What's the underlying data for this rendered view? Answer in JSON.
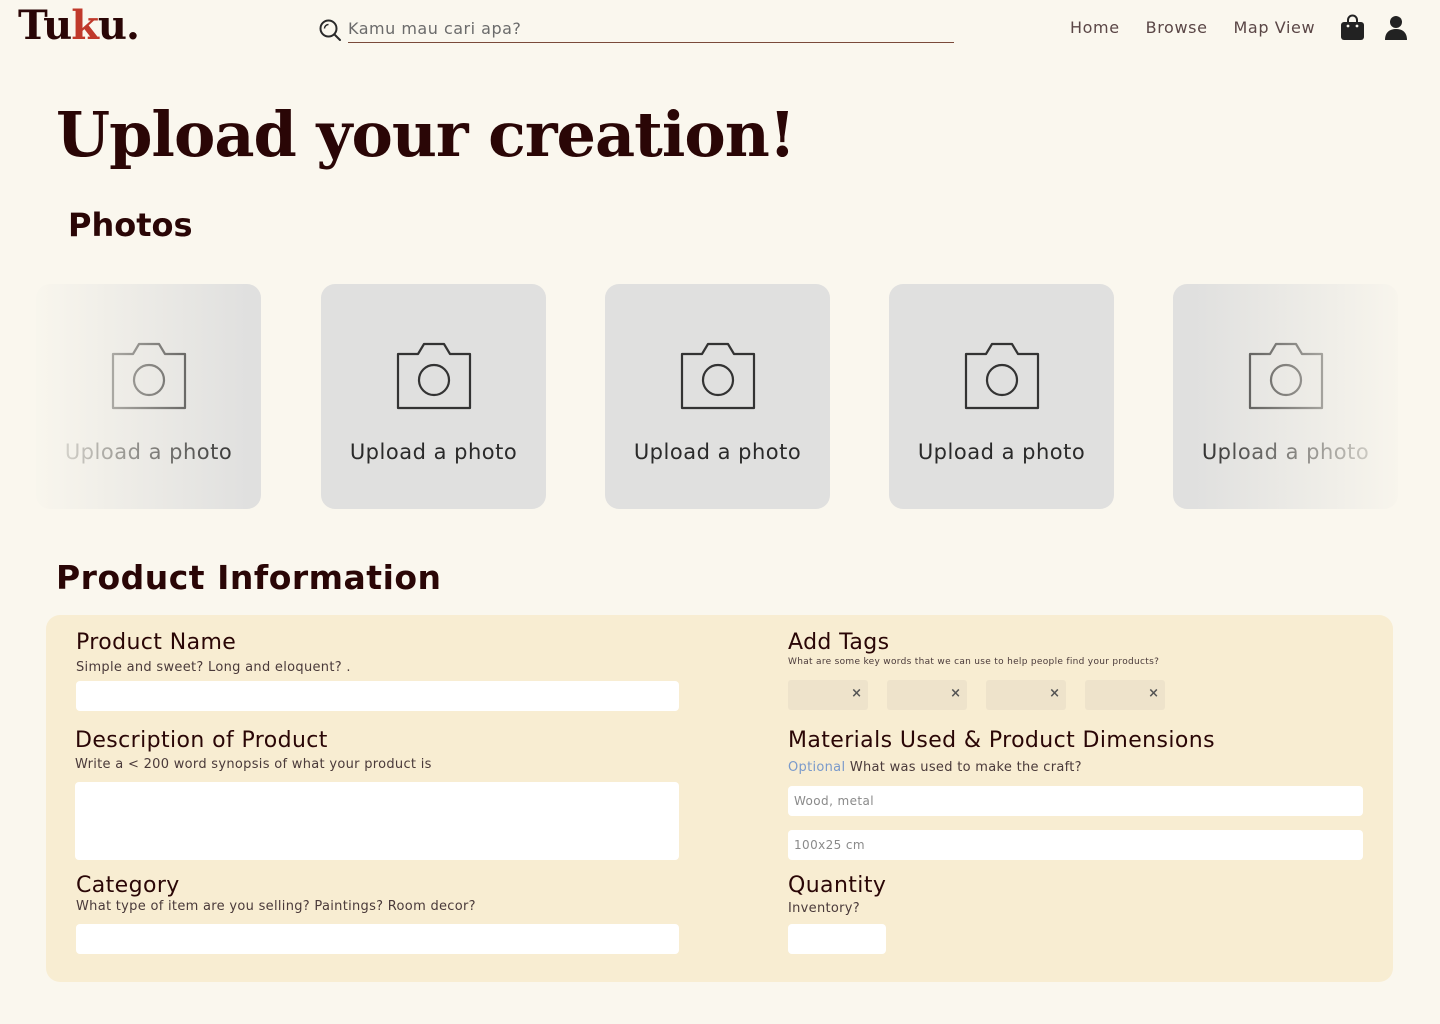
{
  "header": {
    "logo_pre": "Tu",
    "logo_accent": "k",
    "logo_post": "u.",
    "search_placeholder": "Kamu mau cari apa?",
    "nav": [
      "Home",
      "Browse",
      "Map View"
    ]
  },
  "page_title": "Upload your creation!",
  "photos": {
    "heading": "Photos",
    "tiles": [
      "Upload a photo",
      "Upload a photo",
      "Upload a photo",
      "Upload a photo",
      "Upload a photo"
    ]
  },
  "product_info": {
    "heading": "Product Information",
    "product_name": {
      "label": "Product Name",
      "help": "Simple and sweet? Long and eloquent? .",
      "value": ""
    },
    "description": {
      "label": "Description of Product",
      "help": "Write a < 200 word synopsis of what your product is",
      "value": ""
    },
    "category": {
      "label": "Category",
      "help": "What type of item are you selling? Paintings? Room decor?",
      "value": ""
    },
    "tags": {
      "label": "Add Tags",
      "help": "What are some key words that we can use to help people find your products?",
      "items": [
        "",
        "",
        "",
        ""
      ]
    },
    "materials": {
      "label": "Materials Used & Product Dimensions",
      "optional": "Optional",
      "help": "What was used to make the craft?",
      "materials_placeholder": "Wood, metal",
      "dimensions_placeholder": "100x25 cm"
    },
    "quantity": {
      "label": "Quantity",
      "help": "Inventory?",
      "value": ""
    }
  },
  "colors": {
    "background": "#FAF7EE",
    "primary_text": "#2A0606",
    "logo_accent": "#C0392B",
    "form_card": "#F8EDD2",
    "photo_tile": "#E0E0DF"
  }
}
